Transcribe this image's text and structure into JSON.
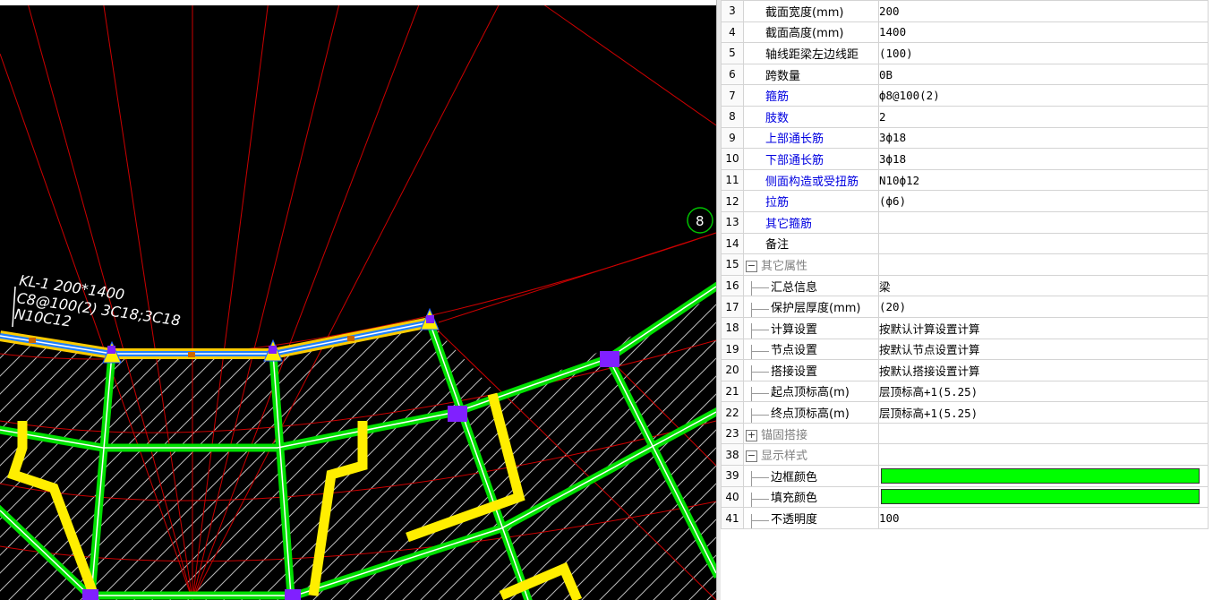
{
  "canvas": {
    "beam_label_line1": "KL-1 200*1400",
    "beam_label_line2": "C8@100(2) 3C18;3C18",
    "beam_label_line3": "N10C12",
    "axis_marker": "8"
  },
  "properties": {
    "rows": [
      {
        "num": "3",
        "name": "截面宽度(mm)",
        "value": "200"
      },
      {
        "num": "4",
        "name": "截面高度(mm)",
        "value": "1400"
      },
      {
        "num": "5",
        "name": "轴线距梁左边线距",
        "value": "(100)"
      },
      {
        "num": "6",
        "name": "跨数量",
        "value": "0B"
      },
      {
        "num": "7",
        "name": "箍筋",
        "value": "ф8@100(2)"
      },
      {
        "num": "8",
        "name": "肢数",
        "value": "2"
      },
      {
        "num": "9",
        "name": "上部通长筋",
        "value": "3ф18"
      },
      {
        "num": "10",
        "name": "下部通长筋",
        "value": "3ф18"
      },
      {
        "num": "11",
        "name": "侧面构造或受扭筋",
        "value": "N10ф12"
      },
      {
        "num": "12",
        "name": "拉筋",
        "value": "(ф6)"
      },
      {
        "num": "13",
        "name": "其它箍筋",
        "value": ""
      },
      {
        "num": "14",
        "name": "备注",
        "value": ""
      },
      {
        "num": "15",
        "name": "其它属性",
        "value": "",
        "toggle": "−"
      },
      {
        "num": "16",
        "name": "汇总信息",
        "value": "梁"
      },
      {
        "num": "17",
        "name": "保护层厚度(mm)",
        "value": "(20)"
      },
      {
        "num": "18",
        "name": "计算设置",
        "value": "按默认计算设置计算"
      },
      {
        "num": "19",
        "name": "节点设置",
        "value": "按默认节点设置计算"
      },
      {
        "num": "20",
        "name": "搭接设置",
        "value": "按默认搭接设置计算"
      },
      {
        "num": "21",
        "name": "起点顶标高(m)",
        "value": "层顶标高+1(5.25)"
      },
      {
        "num": "22",
        "name": "终点顶标高(m)",
        "value": "层顶标高+1(5.25)"
      },
      {
        "num": "23",
        "name": "锚固搭接",
        "value": "",
        "toggle": "+"
      },
      {
        "num": "38",
        "name": "显示样式",
        "value": "",
        "toggle": "−"
      },
      {
        "num": "39",
        "name": "边框颜色",
        "value": ""
      },
      {
        "num": "40",
        "name": "填充颜色",
        "value": ""
      },
      {
        "num": "41",
        "name": "不透明度",
        "value": "100"
      }
    ],
    "border_color": "#00ff00",
    "fill_color": "#00ff00"
  }
}
